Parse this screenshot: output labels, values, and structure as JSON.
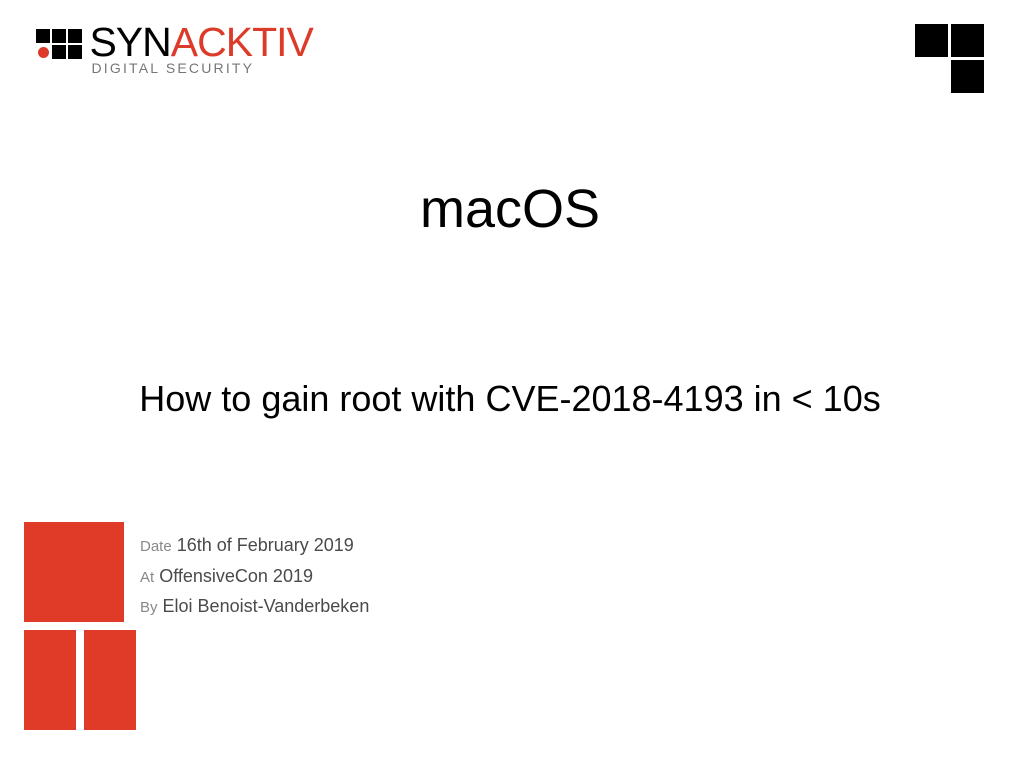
{
  "logo": {
    "part1": "SYN",
    "part2": "ACKTIV",
    "subtitle": "DIGITAL SECURITY"
  },
  "title": "macOS",
  "subtitle": "How to gain root with CVE-2018-4193 in < 10s",
  "meta": {
    "date_label": "Date",
    "date_value": "16th of February 2019",
    "at_label": "At",
    "at_value": "OffensiveCon 2019",
    "by_label": "By",
    "by_value": "Eloi Benoist-Vanderbeken"
  }
}
